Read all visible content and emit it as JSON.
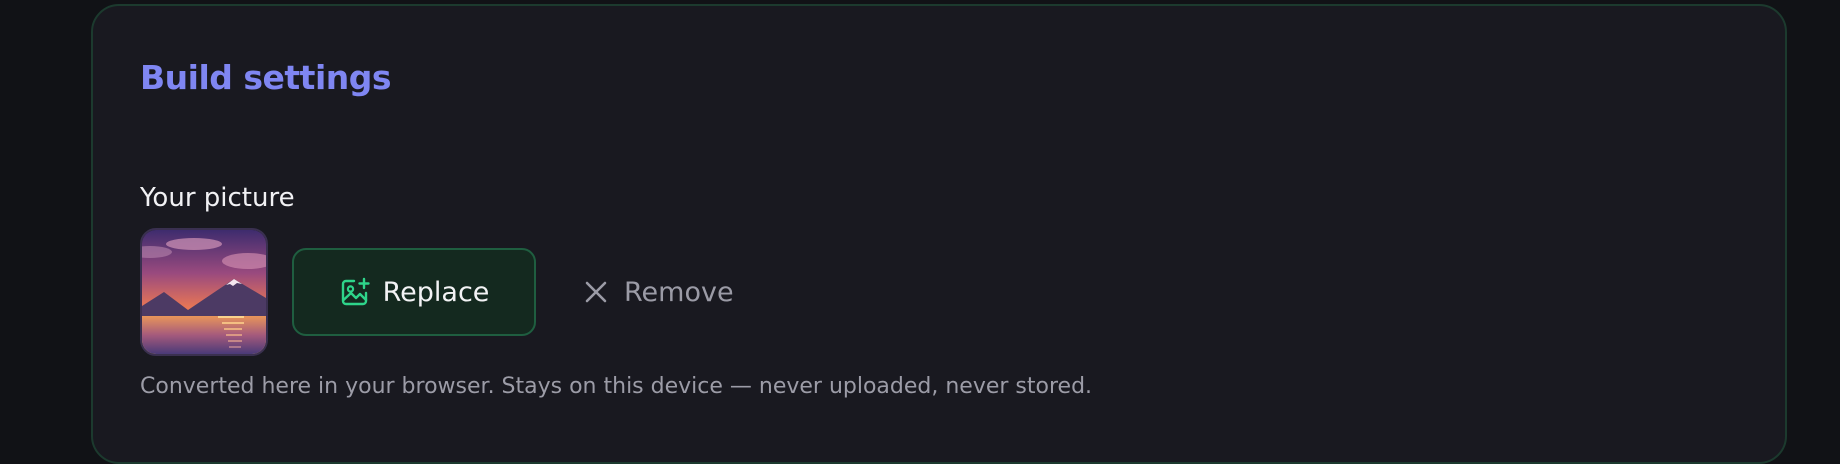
{
  "section": {
    "title": "Build settings"
  },
  "picture": {
    "label": "Your picture",
    "thumbnail_icon": "sunset-mountain-lake-image",
    "replace_label": "Replace",
    "replace_icon": "image-add-icon",
    "remove_label": "Remove",
    "remove_icon": "close-icon",
    "help_text": "Converted here in your browser. Stays on this device — never uploaded, never stored."
  },
  "colors": {
    "accent_title": "#7f86f2",
    "accent_green": "#2ed48a",
    "card_bg": "#191920",
    "page_bg": "#111216"
  }
}
